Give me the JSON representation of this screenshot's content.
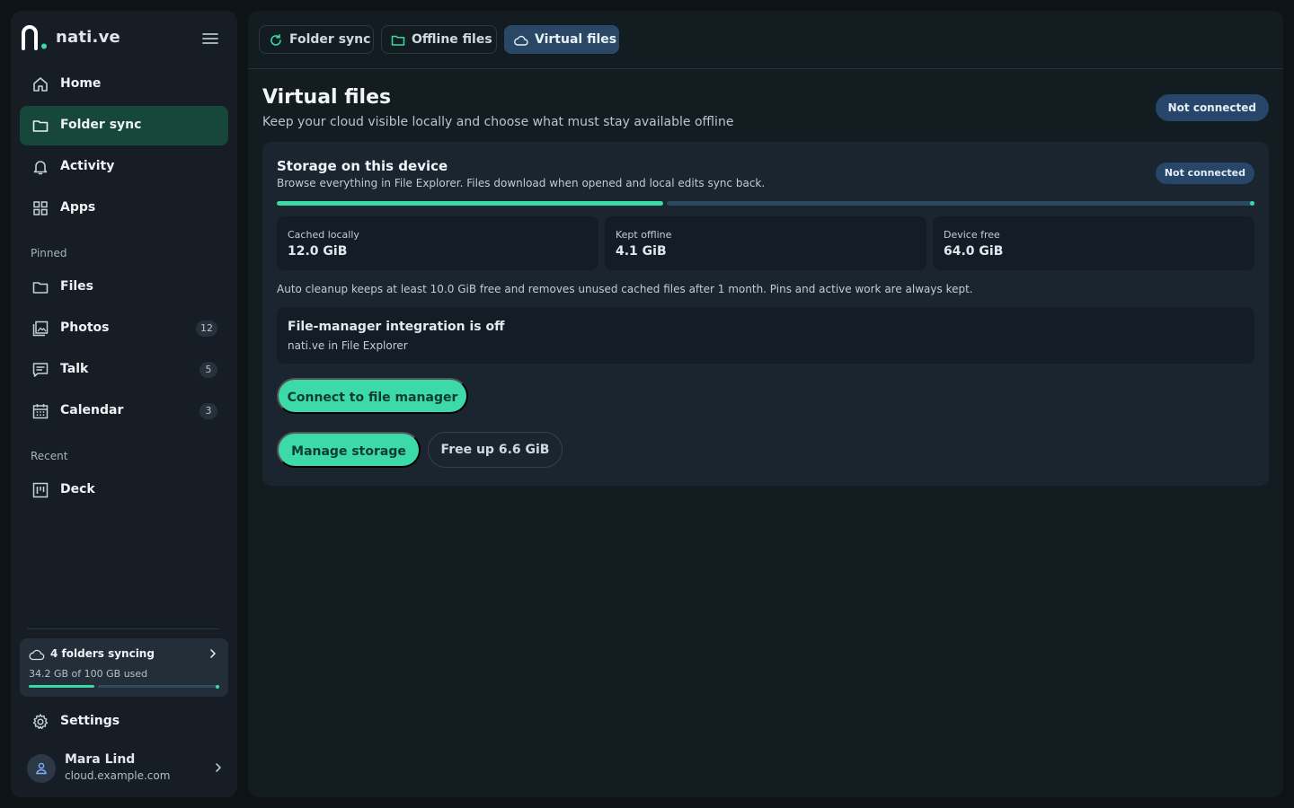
{
  "brand": {
    "name": "nati.ve"
  },
  "nav": {
    "primary": [
      {
        "label": "Home",
        "icon": "home-icon"
      },
      {
        "label": "Folder sync",
        "icon": "folder-icon",
        "active": true
      },
      {
        "label": "Activity",
        "icon": "bell-icon"
      },
      {
        "label": "Apps",
        "icon": "grid-icon"
      }
    ],
    "pinned_label": "Pinned",
    "pinned": [
      {
        "label": "Files",
        "icon": "folder-icon",
        "badge": ""
      },
      {
        "label": "Photos",
        "icon": "photos-icon",
        "badge": "12"
      },
      {
        "label": "Talk",
        "icon": "chat-icon",
        "badge": "5"
      },
      {
        "label": "Calendar",
        "icon": "calendar-icon",
        "badge": "3"
      }
    ],
    "recent_label": "Recent",
    "recent": [
      {
        "label": "Deck",
        "icon": "deck-icon"
      }
    ],
    "settings_label": "Settings"
  },
  "sync_card": {
    "title": "4 folders syncing",
    "usage": "34.2 GB of 100 GB used",
    "used_fraction": 0.342
  },
  "user": {
    "name": "Mara Lind",
    "server": "cloud.example.com"
  },
  "tabs": [
    {
      "label": "Folder sync",
      "icon": "refresh-icon",
      "active": false
    },
    {
      "label": "Offline files",
      "icon": "folder-icon",
      "active": false
    },
    {
      "label": "Virtual files",
      "icon": "cloud-icon",
      "active": true
    }
  ],
  "page": {
    "title": "Virtual files",
    "subtitle": "Keep your cloud visible locally and choose what must stay available offline",
    "status": "Not connected"
  },
  "storage": {
    "title": "Storage on this device",
    "subtitle": "Browse everything in File Explorer. Files download when opened and local edits sync back.",
    "status": "Not connected",
    "used_fraction": 0.395,
    "stats": [
      {
        "label": "Cached locally",
        "value": "12.0 GiB"
      },
      {
        "label": "Kept offline",
        "value": "4.1 GiB"
      },
      {
        "label": "Device free",
        "value": "64.0 GiB"
      }
    ],
    "cleanup_note": "Auto cleanup keeps at least 10.0 GiB free and removes unused cached files after 1 month. Pins and active work are always kept."
  },
  "integration": {
    "title": "File-manager integration is off",
    "subtitle": "nati.ve in File Explorer"
  },
  "actions": {
    "connect": "Connect to file manager",
    "manage": "Manage storage",
    "free_up": "Free up 6.6 GiB"
  },
  "colors": {
    "accent": "#3cdaa8",
    "active_nav": "#17473a",
    "active_tab": "#2a4866",
    "status_pill": "#27466a"
  }
}
